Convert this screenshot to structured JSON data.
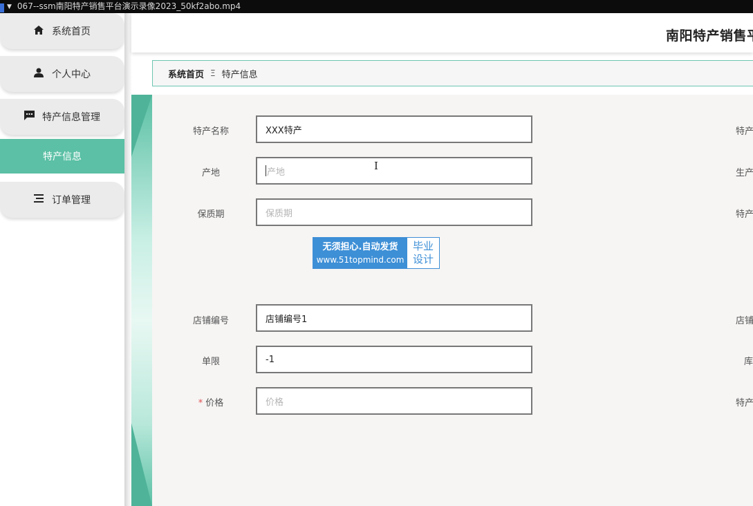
{
  "video_bar": {
    "title": "067--ssm南阳特产销售平台演示录像2023_50kf2abo.mp4"
  },
  "sidebar": {
    "items": [
      {
        "label": "系统首页",
        "icon": "home-icon"
      },
      {
        "label": "个人中心",
        "icon": "user-icon"
      },
      {
        "label": "特产信息管理",
        "icon": "message-icon"
      },
      {
        "label": "订单管理",
        "icon": "list-icon"
      }
    ],
    "active_sub": "特产信息"
  },
  "header": {
    "title": "南阳特产销售平"
  },
  "breadcrumb": {
    "home": "系统首页",
    "separator": "Ξ",
    "current": "特产信息"
  },
  "form": {
    "fields": [
      {
        "label": "特产名称",
        "value": "XXX特产",
        "placeholder": ""
      },
      {
        "label": "产地",
        "value": "",
        "placeholder": "产地"
      },
      {
        "label": "保质期",
        "value": "",
        "placeholder": "保质期"
      },
      {
        "label": "店铺编号",
        "value": "店铺编号1",
        "placeholder": ""
      },
      {
        "label": "单限",
        "value": "-1",
        "placeholder": ""
      },
      {
        "label": "价格",
        "value": "",
        "placeholder": "价格",
        "required_mark": "*"
      }
    ],
    "right_labels": [
      "特产",
      "生产",
      "特产",
      "店铺",
      "库",
      "特产"
    ]
  },
  "watermark": {
    "line1": "无须担心.自动发货",
    "line2": "www.51topmind.com",
    "right1": "毕业",
    "right2": "设计"
  },
  "colors": {
    "accent": "#5bc0a5",
    "watermark_blue": "#3d8fd6",
    "required": "#e05050"
  }
}
